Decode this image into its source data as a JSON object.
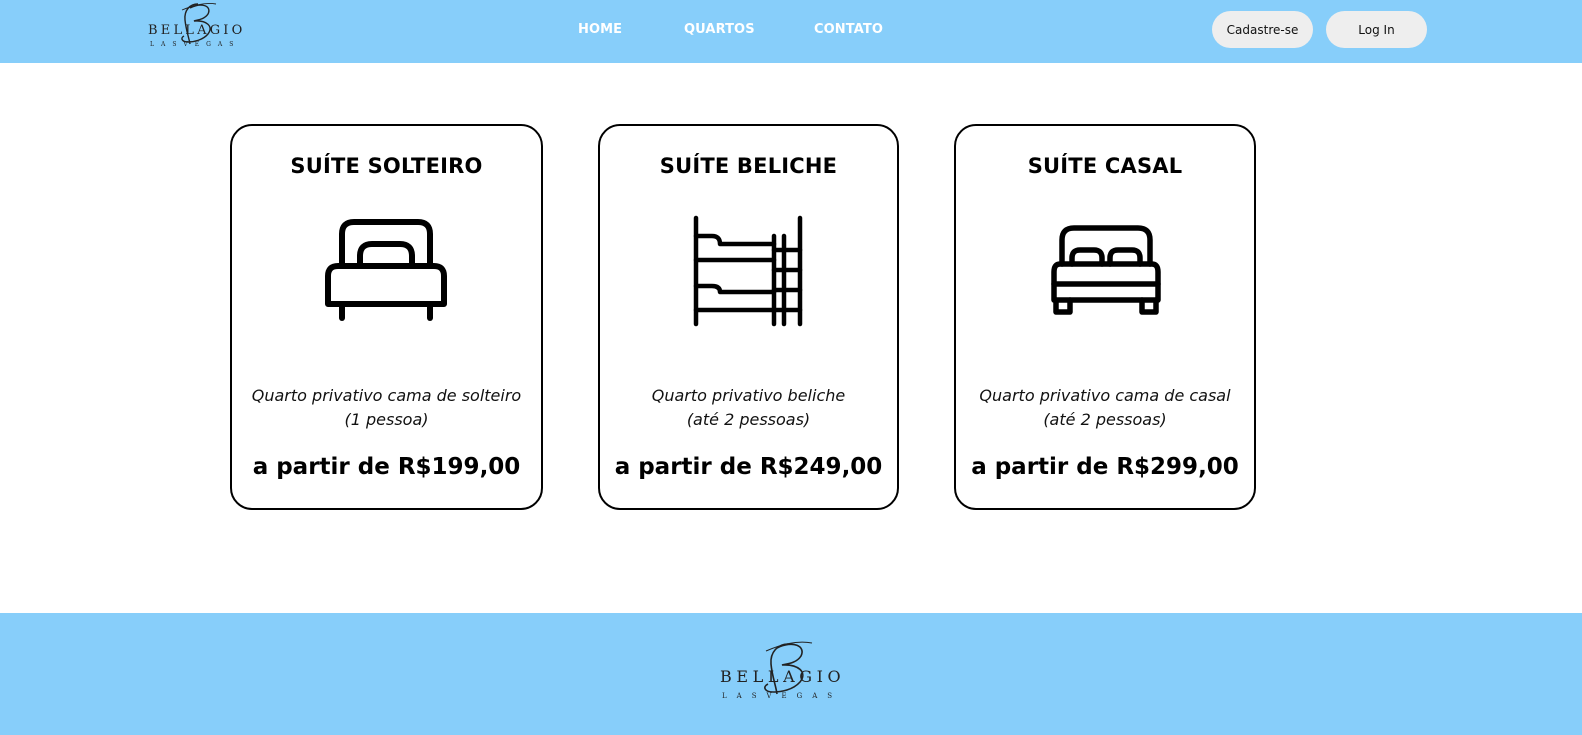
{
  "header": {
    "logo_text": "BELLAGIO",
    "logo_subtext": "LAS VEGAS",
    "nav": [
      {
        "label": "HOME"
      },
      {
        "label": "QUARTOS"
      },
      {
        "label": "CONTATO"
      }
    ],
    "signup_label": "Cadastre-se",
    "login_label": "Log In",
    "background_color": "#87CEFA"
  },
  "rooms": [
    {
      "title": "SUÍTE SOLTEIRO",
      "icon": "single-bed-icon",
      "desc_line1": "Quarto privativo cama de solteiro",
      "desc_line2": "(1 pessoa)",
      "price": "a partir de R$199,00"
    },
    {
      "title": "SUÍTE BELICHE",
      "icon": "bunk-bed-icon",
      "desc_line1": "Quarto privativo beliche",
      "desc_line2": "(até 2 pessoas)",
      "price": "a partir de R$249,00"
    },
    {
      "title": "SUÍTE CASAL",
      "icon": "double-bed-icon",
      "desc_line1": "Quarto privativo cama de casal",
      "desc_line2": "(até 2 pessoas)",
      "price": "a partir de R$299,00"
    }
  ],
  "footer": {
    "logo_text": "BELLAGIO",
    "logo_subtext": "LAS VEGAS"
  }
}
